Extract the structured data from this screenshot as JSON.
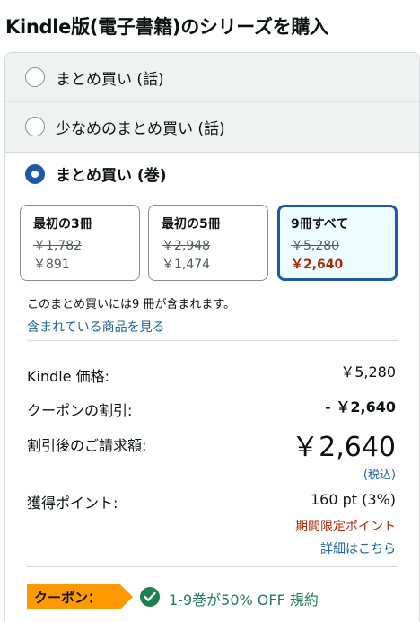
{
  "title": "Kindle版(電子書籍)のシリーズを購入",
  "options": [
    {
      "label": "まとめ買い (話)",
      "selected": false
    },
    {
      "label": "少なめのまとめ買い (話)",
      "selected": false
    },
    {
      "label": "まとめ買い (巻)",
      "selected": true
    }
  ],
  "bundles": [
    {
      "title": "最初の3冊",
      "list_price": "￥1,782",
      "price": "￥891",
      "selected": false
    },
    {
      "title": "最初の5冊",
      "list_price": "￥2,948",
      "price": "￥1,474",
      "selected": false
    },
    {
      "title": "9冊すべて",
      "list_price": "￥5,280",
      "price": "￥2,640",
      "selected": true
    }
  ],
  "included_text": "このまとめ買いには9 冊が含まれます。",
  "see_items_link": "含まれている商品を見る",
  "pricing": {
    "kindle_price_label": "Kindle 価格:",
    "kindle_price": "￥5,280",
    "coupon_discount_label": "クーポンの割引:",
    "coupon_discount": "- ￥2,640",
    "total_label": "割引後のご請求額:",
    "total": "￥2,640",
    "tax_note": "(税込)",
    "points_label": "獲得ポイント:",
    "points": "160 pt (3%)",
    "limited_points": "期間限定ポイント",
    "details_link": "詳細はこちら"
  },
  "coupon": {
    "badge": "クーポン：",
    "text": "1-9巻が50% OFF 規約",
    "icon": "check-circle-icon",
    "color": "#1e7f53"
  },
  "colors": {
    "accent": "#1f5aa8",
    "link": "#2162a1",
    "price_red": "#b12704",
    "badge_orange": "#ff9900"
  }
}
